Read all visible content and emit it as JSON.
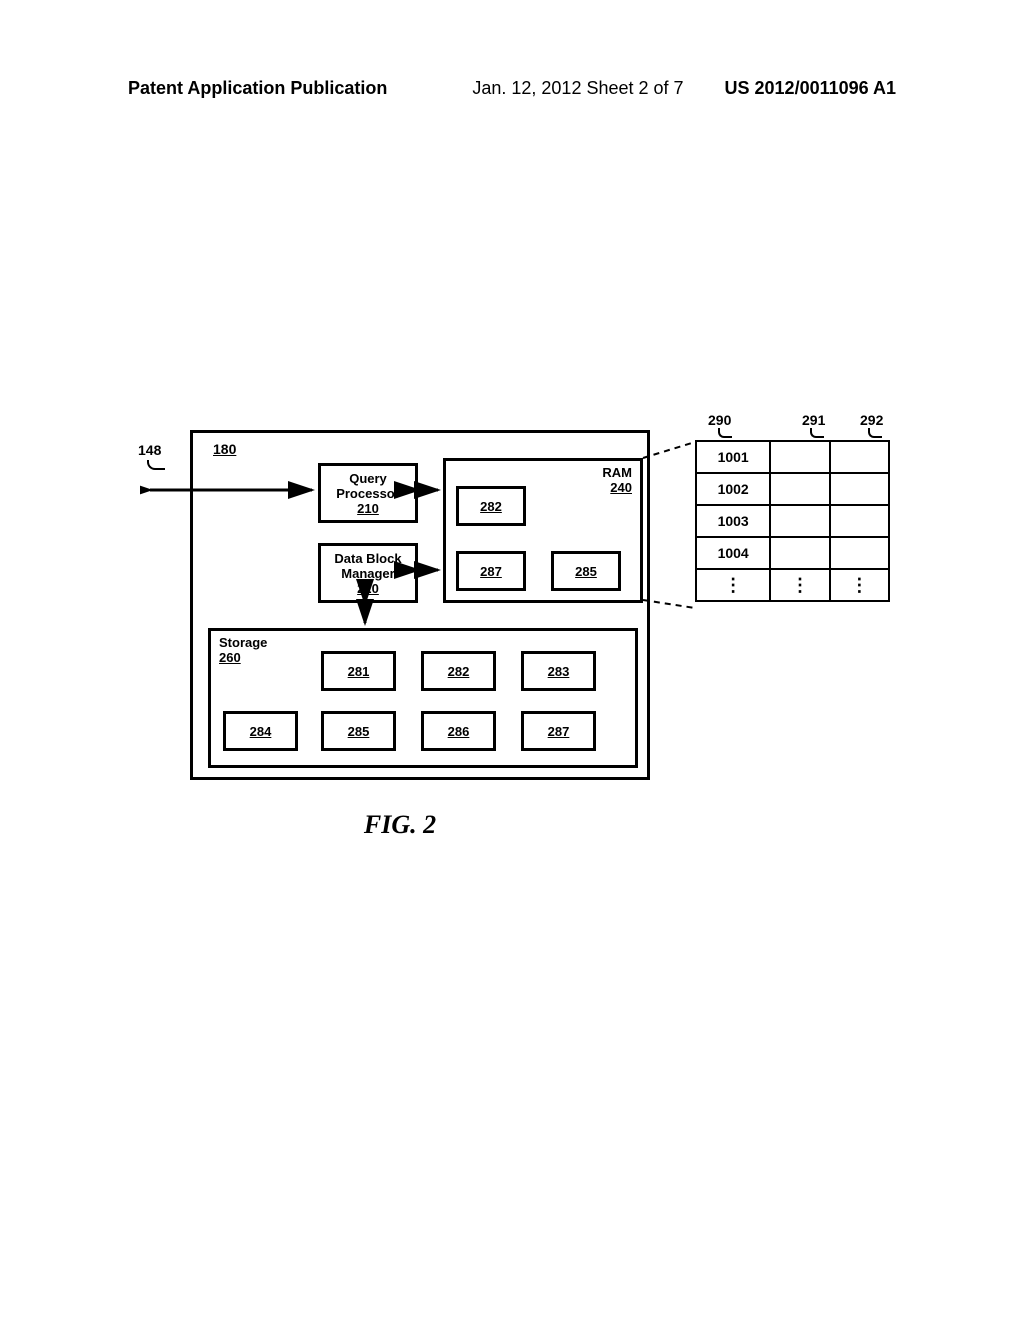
{
  "header": {
    "left": "Patent Application Publication",
    "mid": "Jan. 12, 2012  Sheet 2 of 7",
    "right": "US 2012/0011096 A1"
  },
  "figure": {
    "caption": "FIG. 2",
    "ext_ref": "148",
    "sys_ref": "180",
    "query_processor": {
      "name": "Query Processor",
      "ref": "210"
    },
    "data_block_manager": {
      "name": "Data Block Manager",
      "ref": "220"
    },
    "ram": {
      "name": "RAM",
      "ref": "240",
      "blocks": {
        "a": "282",
        "b": "287",
        "c": "285"
      }
    },
    "storage": {
      "name": "Storage",
      "ref": "260",
      "blocks": {
        "a": "281",
        "b": "282",
        "c": "283",
        "d": "284",
        "e": "285",
        "f": "286",
        "g": "287"
      }
    },
    "table": {
      "col_refs": {
        "c0": "290",
        "c1": "291",
        "c2": "292"
      },
      "rows": {
        "r0": "1001",
        "r1": "1002",
        "r2": "1003",
        "r3": "1004"
      },
      "ellipsis": "⋮"
    }
  }
}
